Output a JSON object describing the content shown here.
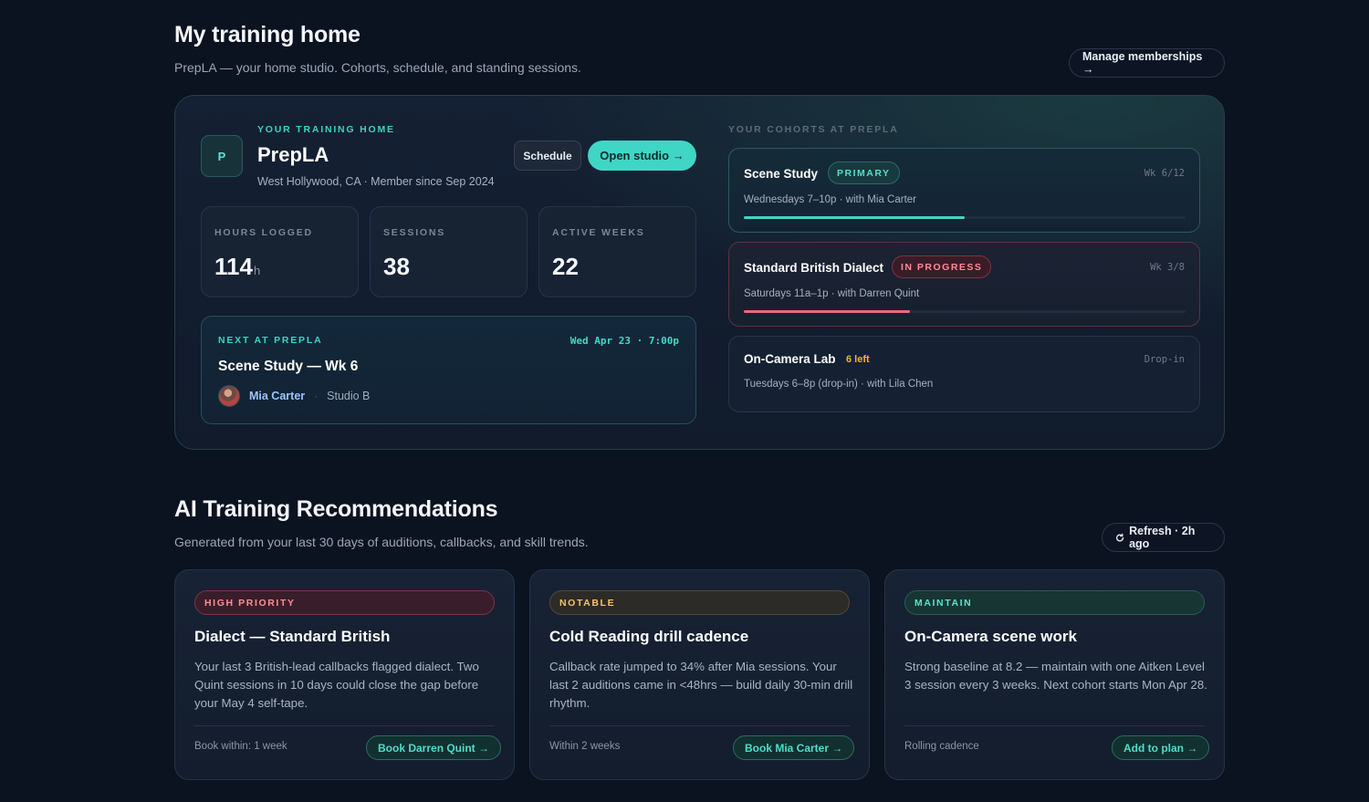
{
  "home": {
    "title": "My training home",
    "subtitle": "PrepLA — your home studio. Cohorts, schedule, and standing sessions.",
    "manage_label": "Manage memberships →"
  },
  "studio": {
    "eyebrow": "YOUR TRAINING HOME",
    "initial": "P",
    "name": "PrepLA",
    "meta": "West Hollywood, CA · Member since Sep 2024",
    "schedule_label": "Schedule",
    "open_label": "Open studio →"
  },
  "stats": [
    {
      "label": "HOURS LOGGED",
      "value": "114",
      "unit": "h"
    },
    {
      "label": "SESSIONS",
      "value": "38",
      "unit": ""
    },
    {
      "label": "ACTIVE WEEKS",
      "value": "22",
      "unit": ""
    }
  ],
  "next": {
    "eyebrow": "NEXT AT PREPLA",
    "datetime": "Wed Apr 23 · 7:00p",
    "title": "Scene Study — Wk 6",
    "person": "Mia Carter",
    "separator": "·",
    "studio": "Studio B"
  },
  "cohorts": {
    "eyebrow": "YOUR COHORTS AT PREPLA",
    "items": [
      {
        "name": "Scene Study",
        "badge": "PRIMARY",
        "week": "Wk 6/12",
        "detail": "Wednesdays 7–10p · with Mia Carter",
        "progress": 0.5
      },
      {
        "name": "Standard British Dialect",
        "badge": "IN PROGRESS",
        "week": "Wk 3/8",
        "detail": "Saturdays 11a–1p · with Darren Quint",
        "progress": 0.375
      },
      {
        "name": "On-Camera Lab",
        "seats": "6 left",
        "week": "Drop-in",
        "detail": "Tuesdays 6–8p (drop-in) · with Lila Chen"
      }
    ]
  },
  "ai": {
    "title": "AI Training Recommendations",
    "subtitle": "Generated from your last 30 days of auditions, callbacks, and skill trends.",
    "refresh_label": "Refresh · 2h ago",
    "recs": [
      {
        "tag": "HIGH PRIORITY",
        "title": "Dialect — Standard British",
        "body": "Your last 3 British-lead callbacks flagged dialect. Two Quint sessions in 10 days could close the gap before your May 4 self-tape.",
        "foot": "Book within: 1 week",
        "cta": "Book Darren Quint →"
      },
      {
        "tag": "NOTABLE",
        "title": "Cold Reading drill cadence",
        "body": "Callback rate jumped to 34% after Mia sessions. Your last 2 auditions came in <48hrs — build daily 30-min drill rhythm.",
        "foot": "Within 2 weeks",
        "cta": "Book Mia Carter →"
      },
      {
        "tag": "MAINTAIN",
        "title": "On-Camera scene work",
        "body": "Strong baseline at 8.2 — maintain with one Aitken Level 3 session every 3 weeks. Next cohort starts Mon Apr 28.",
        "foot": "Rolling cadence",
        "cta": "Add to plan →"
      }
    ]
  },
  "colors": {
    "accent": "#3fd6c6",
    "danger": "#f06a74",
    "warning": "#f0c56c",
    "background": "#0b1220"
  },
  "icons": {
    "refresh": "refresh-icon",
    "arrow": "arrow-right-icon"
  }
}
